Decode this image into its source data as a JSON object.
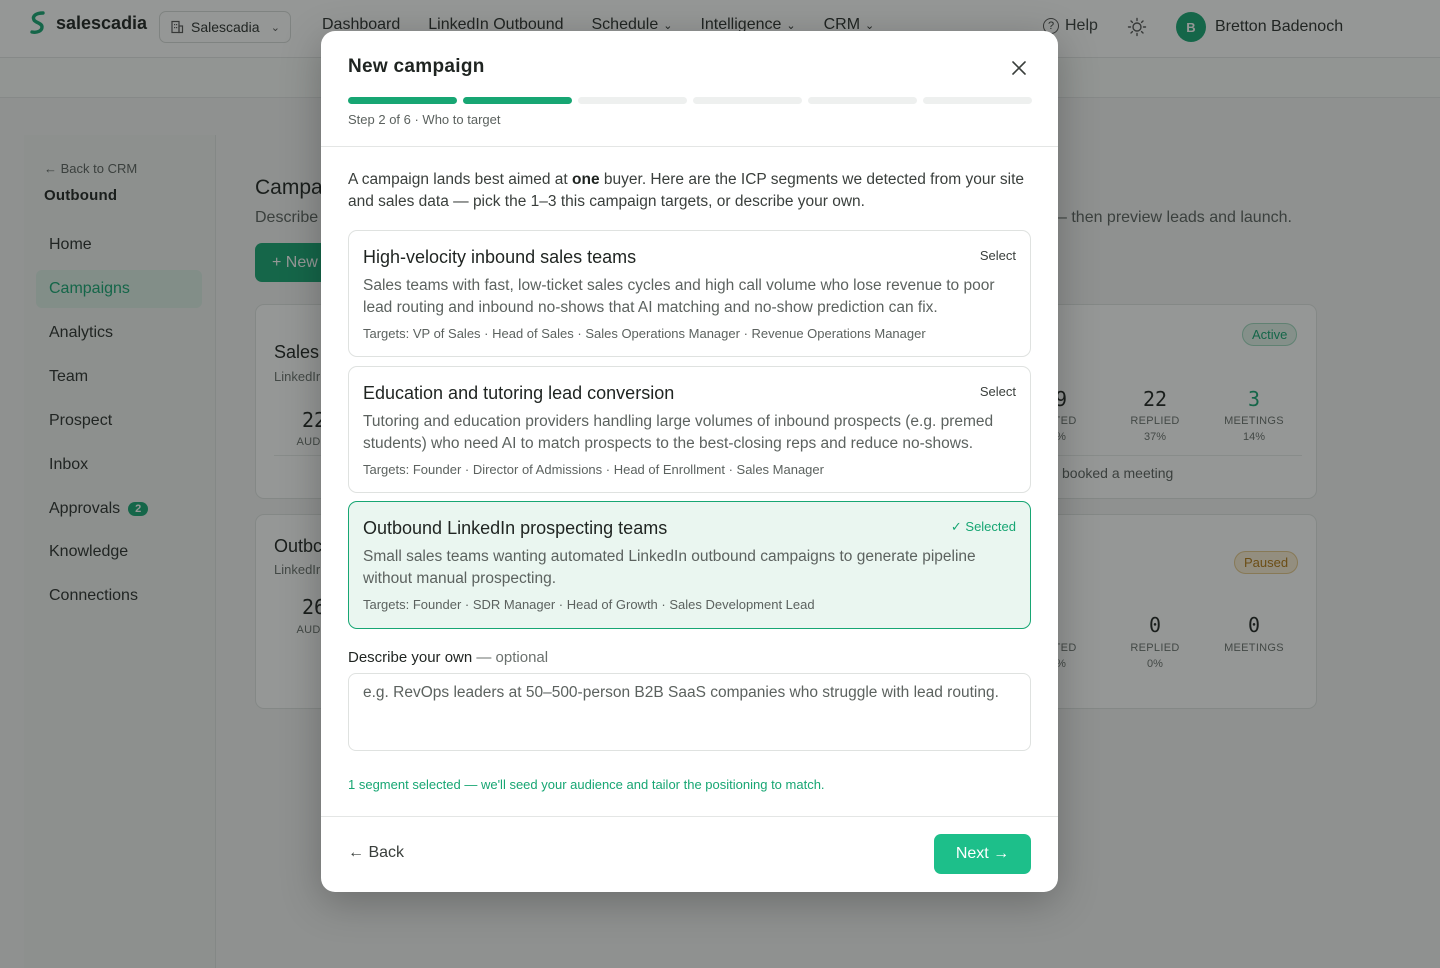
{
  "brand": {
    "name": "salescadia",
    "accent": "#17a673",
    "accent_light": "#1dbf8a"
  },
  "topbar": {
    "workspace": "Salescadia",
    "nav": [
      "Dashboard",
      "LinkedIn Outbound",
      "Schedule",
      "Intelligence",
      "CRM"
    ],
    "help": "Help",
    "user_initial": "B",
    "user_name": "Bretton Badenoch"
  },
  "sidebar": {
    "back": "← Back to CRM",
    "title": "Outbound",
    "items": [
      {
        "label": "Home"
      },
      {
        "label": "Campaigns"
      },
      {
        "label": "Analytics"
      },
      {
        "label": "Team"
      },
      {
        "label": "Prospect"
      },
      {
        "label": "Inbox"
      },
      {
        "label": "Approvals",
        "badge": "2"
      },
      {
        "label": "Knowledge"
      },
      {
        "label": "Connections"
      }
    ]
  },
  "main": {
    "title": "Campa",
    "desc": "Describe",
    "desc_right": "– then preview leads and launch.",
    "new_button": "+ New",
    "campaigns": [
      {
        "name": "Sales",
        "sub": "LinkedIr",
        "audience_num": "22",
        "audience_lbl": "AUDIE",
        "connected_num": "9",
        "connected_lbl": "CTED",
        "connected_pct": "%",
        "replied_num": "22",
        "replied_lbl": "REPLIED",
        "replied_pct": "37%",
        "meetings_num": "3",
        "meetings_lbl": "MEETINGS",
        "meetings_pct": "14%",
        "status": "Active",
        "footer": "booked a meeting"
      },
      {
        "name": "Outbc",
        "sub": "LinkedIr",
        "audience_num": "26",
        "audience_lbl": "AUDIE",
        "connected_lbl": "CTED",
        "connected_pct": "%",
        "replied_num": "0",
        "replied_lbl": "REPLIED",
        "replied_pct": "0%",
        "meetings_num": "0",
        "meetings_lbl": "MEETINGS",
        "status": "Paused"
      }
    ]
  },
  "modal": {
    "title": "New campaign",
    "progress": {
      "current": 2,
      "total": 6
    },
    "step_label": "Step 2 of 6 · Who to target",
    "intro_pre": "A campaign lands best aimed at ",
    "intro_bold": "one",
    "intro_post": " buyer. Here are the ICP segments we detected from your site and sales data — pick the 1–3 this campaign targets, or describe your own.",
    "segments": [
      {
        "title": "High-velocity inbound sales teams",
        "action": "Select",
        "selected": false,
        "desc": "Sales teams with fast, low-ticket sales cycles and high call volume who lose revenue to poor lead routing and inbound no-shows that AI matching and no-show prediction can fix.",
        "targets": "Targets: VP of Sales · Head of Sales · Sales Operations Manager · Revenue Operations Manager"
      },
      {
        "title": "Education and tutoring lead conversion",
        "action": "Select",
        "selected": false,
        "desc": "Tutoring and education providers handling large volumes of inbound prospects (e.g. premed students) who need AI to match prospects to the best-closing reps and reduce no-shows.",
        "targets": "Targets: Founder · Director of Admissions · Head of Enrollment · Sales Manager"
      },
      {
        "title": "Outbound LinkedIn prospecting teams",
        "action": "✓ Selected",
        "selected": true,
        "desc": "Small sales teams wanting automated LinkedIn outbound campaigns to generate pipeline without manual prospecting.",
        "targets": "Targets: Founder · SDR Manager · Head of Growth · Sales Development Lead"
      }
    ],
    "own_label": "Describe your own",
    "own_optional": " — optional",
    "own_value": "",
    "own_placeholder": "e.g. RevOps leaders at 50–500-person B2B SaaS companies who struggle with lead routing.",
    "selected_note": "1 segment selected — we'll seed your audience and tailor the positioning to match.",
    "back": "← Back",
    "next": "Next →"
  }
}
